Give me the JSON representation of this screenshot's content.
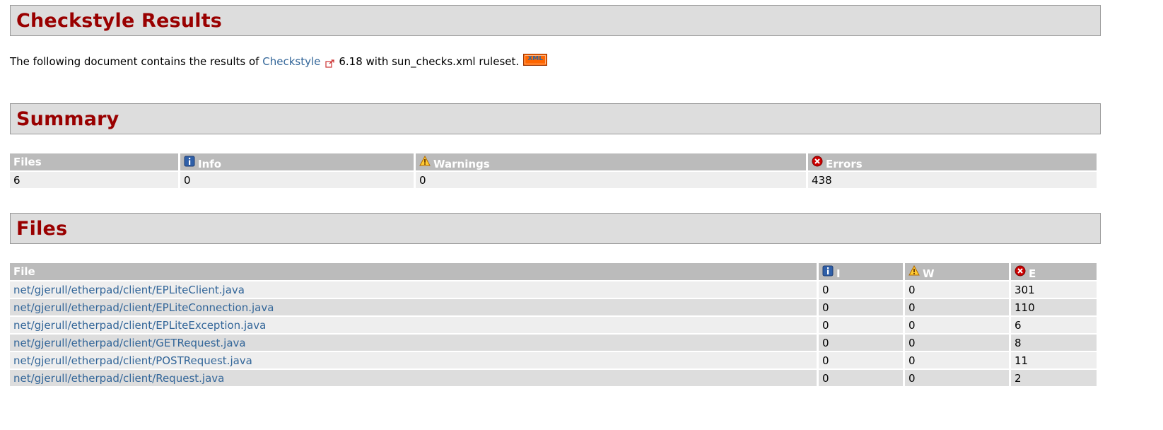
{
  "header": {
    "title": "Checkstyle Results"
  },
  "intro": {
    "prefix": "The following document contains the results of",
    "link_text": "Checkstyle",
    "suffix": "6.18 with sun_checks.xml ruleset.",
    "xml_badge": "XML"
  },
  "summary": {
    "title": "Summary",
    "columns": {
      "files": "Files",
      "info": "Info",
      "warnings": "Warnings",
      "errors": "Errors"
    },
    "values": {
      "files": "6",
      "info": "0",
      "warnings": "0",
      "errors": "438"
    }
  },
  "files": {
    "title": "Files",
    "columns": {
      "file": "File",
      "info": "I",
      "warnings": "W",
      "errors": "E"
    },
    "rows": [
      {
        "file": "net/gjerull/etherpad/client/EPLiteClient.java",
        "info": "0",
        "warnings": "0",
        "errors": "301"
      },
      {
        "file": "net/gjerull/etherpad/client/EPLiteConnection.java",
        "info": "0",
        "warnings": "0",
        "errors": "110"
      },
      {
        "file": "net/gjerull/etherpad/client/EPLiteException.java",
        "info": "0",
        "warnings": "0",
        "errors": "6"
      },
      {
        "file": "net/gjerull/etherpad/client/GETRequest.java",
        "info": "0",
        "warnings": "0",
        "errors": "8"
      },
      {
        "file": "net/gjerull/etherpad/client/POSTRequest.java",
        "info": "0",
        "warnings": "0",
        "errors": "11"
      },
      {
        "file": "net/gjerull/etherpad/client/Request.java",
        "info": "0",
        "warnings": "0",
        "errors": "2"
      }
    ]
  },
  "colors": {
    "heading": "#990000",
    "link": "#336699",
    "header_bg": "#dddddd",
    "th_bg": "#bbbbbb",
    "row_a": "#eeeeee",
    "row_b": "#dddddd",
    "xml_badge": "#ff6600",
    "error_icon": "#cc0000"
  },
  "icons": {
    "external_link": "external-link-icon",
    "info": "info-icon",
    "warning": "warning-icon",
    "error": "error-icon"
  }
}
